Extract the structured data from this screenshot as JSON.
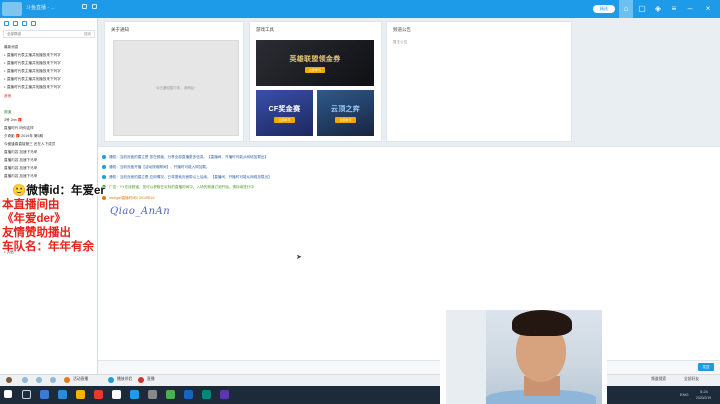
{
  "titlebar": {
    "title": "斗鱼直播 - ...",
    "pill_label": "精选",
    "buttons": [
      "主页",
      "消息",
      "设置",
      "最小化",
      "关闭"
    ],
    "icons": [
      "user-icon",
      "bell-icon",
      "menu-icon",
      "minimize-icon",
      "close-icon"
    ]
  },
  "sidebar": {
    "search_left": "全部群组",
    "search_right": "搜索",
    "group_header": "最新消息",
    "items": [
      "直播时代表主播并找播放来下列字",
      "直播时代表主播并找播放来下列字",
      "直播时代表主播并找播放来下列字",
      "直播时代表主播并找播放来下列字",
      "直播时代表主播并找播放来下列字"
    ],
    "sub_label": "其他",
    "room_label": "频道",
    "room_items": [
      "3号 2nn 🎁",
      "直播时代 吗你这样",
      "夕奇影 🎁 2019年 第5期",
      "今盛逢春直接第三  还在人下成员",
      "直播内容 加速下马甲",
      "直播内容 加速下马甲",
      "直播内容 加速下马甲",
      "直播内容 加速下马甲"
    ],
    "footer": "其他"
  },
  "cards": {
    "live": {
      "title": "关于通知",
      "placeholder": "今日通知暂时未，请稍后~"
    },
    "game": {
      "title": "游戏工具",
      "banners": [
        {
          "title": "英雄联盟领金券",
          "button": "立即参与",
          "color": "#1b1f27"
        },
        {
          "title": "CF奖金赛",
          "button": "立即参与",
          "color": "#2a3a7a"
        },
        {
          "title": "云顶之弈",
          "button": "立即参与",
          "color": "#22345a"
        }
      ]
    },
    "notice": {
      "title": "频道公告",
      "subtitle": "暂无公告"
    }
  },
  "chat": {
    "messages": [
      {
        "text": "通知：当前页面的建立是 您在频道，分享全部直播更多信息。【直播间，开播时可能从网络加载出】",
        "style": "blue"
      },
      {
        "text": "通知：当前页面开播【活动搜索期间】，开播时可能入网加载。",
        "style": "blue"
      },
      {
        "text": "通知：当前页面的建立是 应用情况，已将搜索页面带以上后续。【直播间，开播时可能从网络加载出】",
        "style": "blue"
      },
      {
        "text": "广告：YY在线频道，您可以获取在实际的直播时间中，入场的频道订阅开始，请持续进行中",
        "style": "green"
      },
      {
        "text": "nicegarl直播时间2 2019年16",
        "style": "orange"
      }
    ],
    "handwriting": "Qiao_AnAn"
  },
  "overlay": {
    "line1": "🙂微博id：年爱er",
    "line2": "本直播间由",
    "line3": "《年爱der》",
    "line4": "友情赞助播出",
    "line5": "车队名：年年有余"
  },
  "input": {
    "send_label": "发送"
  },
  "app_toolbar": {
    "items": [
      "活动直播",
      "播放伴侣",
      "直播"
    ],
    "right_items": [
      "频道搜索",
      "全部好友"
    ]
  },
  "taskbar": {
    "search_label": "",
    "right_text": "ENG",
    "clock": "5:24",
    "date": "2020/2/19"
  }
}
